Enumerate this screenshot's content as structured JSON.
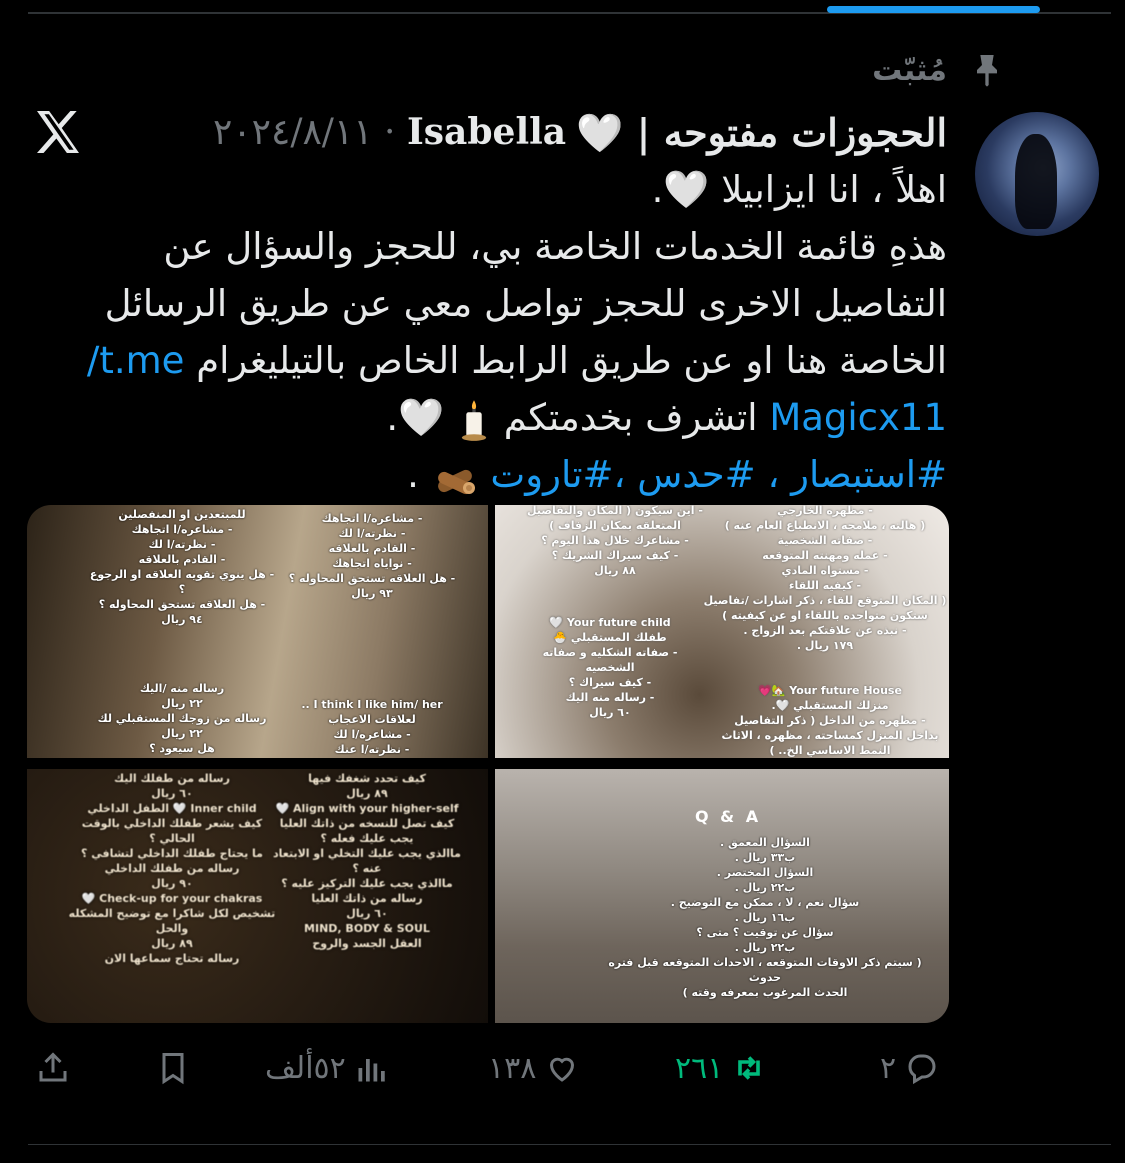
{
  "pinned": {
    "label": "مُثبّت"
  },
  "author": {
    "display_name": "الحجوزات مفتوحه | 🤍",
    "handle": "Isabella",
    "date": "٢٠٢٤/٨/١١"
  },
  "tweet": {
    "lines": [
      "اهلاً ، انا ايزابيلا 🤍.",
      "هذهِ قائمة الخدمات الخاصة بي، للحجز والسؤال عن",
      "التفاصيل الاخرى للحجز تواصل معي عن طريق الرسائل",
      "الخاصة هنا او عن طريق الرابط الخاص بالتيليغرام"
    ],
    "link_part1": "t.me/",
    "link_part2": "Magicx11",
    "after_link": "اتشرف بخدمتكم",
    "after_link_end": "🤍.",
    "hashtags": "#استبصار ، #حدس ،#تاروت",
    "hashtags_end": "."
  },
  "media": {
    "tile1_left": "للمبتعدين او المنفصلين\n- مشاعره/ا اتجاهك\n- نظرته/ا لك\n- القادم بالعلاقه\n- هل ينوي تقويه العلاقه او الرجوع ؟\n- هل العلاقه تستحق المحاوله ؟\n٩٤ ريال",
    "tile1_right": "- مشاعره/ا اتجاهك\n- نظرته/ا لك\n- القادم بالعلاقه\n- نواياه اتجاهك\n- هل العلاقه تستحق المحاوله ؟\n٩٣ ريال",
    "tile1_bottom_left": "رساله منه /اليك\n٢٢ ريال\nرساله من زوجك المستقبلي لك\n٢٢ ريال\nهل سيعود ؟",
    "tile1_bottom_right": "I think I like him/ her ..\nلعلاقات الاعجاب\n- مشاعره/ا لك\n- نظرته/ا عنك",
    "tile2_top_left": "- اين سيكون ( المكان والتفاصيل\nالمتعلقه بمكان الزفاف )\n- مشاعرك خلال هذا اليوم ؟\n- كيف سيراك الشريك ؟\n٨٨ ريال",
    "tile2_top_right": "- مظهره الخارجي\n( هالته ، ملامحه ، الانطباع العام عنه )\n- صفاته الشخصية\n- عمله ومهنته المتوقعه\n- مستواه المادي\n- كيفيه اللقاء\n( المكان المتوقع للقاء ، ذكر اشارات /تفاصيل\nستكون متواجده باللقاء او عن كيفيته )\n- نبذه عن علاقتكم بعد الزواج .\n١٧٩ ريال .",
    "tile2_child": "Your future child 🤍\nطفلك المستقبلي 🐣\n- صفاته الشكليه و صفاته\nالشخصيه\n- كيف سيراك ؟\n- رساله منه اليك\n٦٠ ريال",
    "tile2_house": "Your future House 🏡💗\nمنزلك المستقبلي 🤍.\n- مظهره من الداخل ( ذكر التفاصيل\nبداخل المنزل كمساحته ، مظهره ، الاثاث\nالنمط الاساسي الخ.. )",
    "tile3_left": "رساله من طفلك اليك\n٦٠ ريال\nInner child 🤍 الطفل الداخلي\nكيف يشعر طفلك الداخلي بالوقت\nالحالي ؟\nما يحتاج طفلك الداخلي لتشافي ؟\nرساله من طفلك الداخلي\n٩٠ ريال\nCheck-up for your chakras 🤍\nتشخيص لكل شاكرا مع توضيح المشكله والحل\n٨٩ ريال\nرساله تحتاج سماعها الان",
    "tile3_right": "كيف تحدد شغفك فيها\n٨٩ ريال\nAlign with your higher-self 🤍\nكيف تصل للنسخه من ذاتك العليا\nيجب عليك فعله ؟\nماالذي يجب عليك التخلي او الابتعاد\nعنه ؟\nماالذي يجب عليك التركيز عليه ؟\nرساله من ذاتك العليا\n٦٠ ريال\nMIND, BODY & SOUL\nالعقل الجسد والروح",
    "tile4_qa": "Q & A",
    "tile4_text": "السؤال المعمق .\nب٣٣ ريال .\nالسؤال المختصر .\nب٢٢ ريال .\nسؤال نعم ، لا ، ممكن مع التوضيح .\nب١٦ ريال .\nسؤال عن توقيت ؟ متى ؟\nب٢٢ ريال .\n( سيتم ذكر الاوقات المتوقعه ، الاحداث المتوقعه قبل فتره حدوث\nالحدث المرغوب بمعرفه وقته )"
  },
  "actions": {
    "replies": "٢",
    "retweets": "٢٦١",
    "likes": "١٣٨",
    "views": "٥٢ألف"
  },
  "colors": {
    "background": "#000000",
    "text": "#e7e9ea",
    "muted": "#71767b",
    "link": "#1d9bf0",
    "retweet_active": "#00ba7c"
  }
}
